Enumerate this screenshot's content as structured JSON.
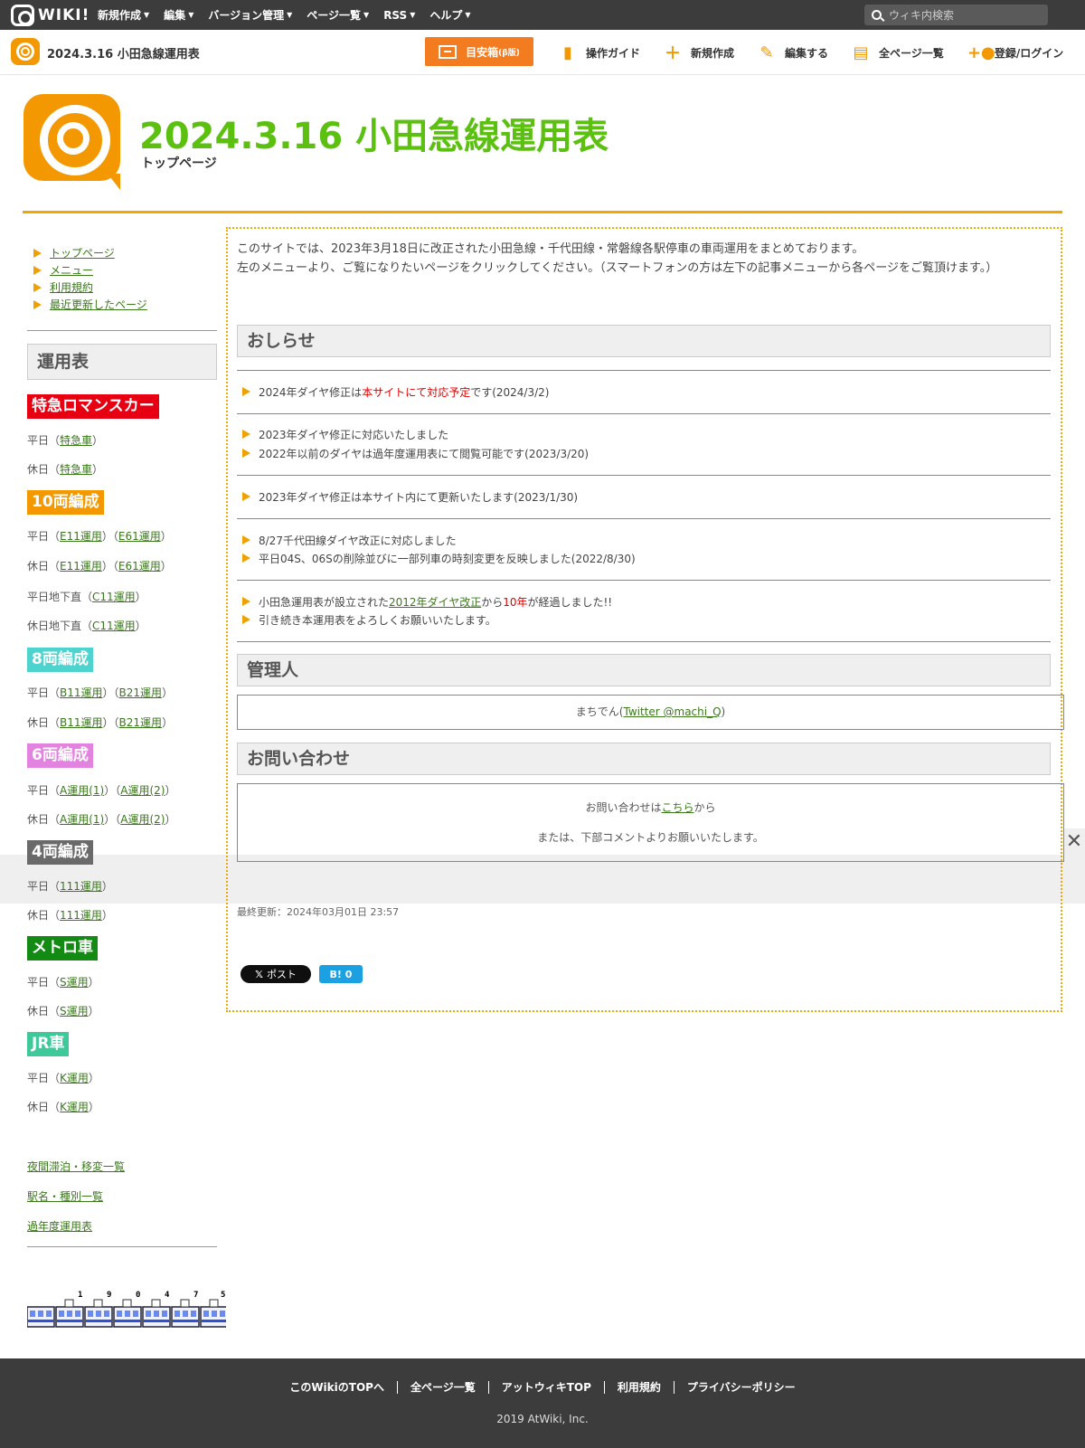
{
  "topbar": {
    "logo_text": "WIKI!",
    "nav": [
      "新規作成",
      "編集",
      "バージョン管理",
      "ページ一覧",
      "RSS",
      "ヘルプ"
    ],
    "search_placeholder": "ウィキ内検索"
  },
  "subbar": {
    "site_title": "2024.3.16 小田急線運用表",
    "mokuji_label": "目安箱",
    "mokuji_small": "(β版)",
    "tools": [
      {
        "icon": "book-icon",
        "label": "操作ガイド"
      },
      {
        "icon": "plus-icon",
        "label": "新規作成"
      },
      {
        "icon": "pencil-icon",
        "label": "編集する"
      },
      {
        "icon": "document-icon",
        "label": "全ページ一覧"
      },
      {
        "icon": "users-icon",
        "label": "登録/ログイン"
      }
    ]
  },
  "header": {
    "title": "2024.3.16 小田急線運用表",
    "subtitle": "トップページ"
  },
  "sidebar": {
    "links": [
      "トップページ",
      "メニュー",
      "利用規約",
      "最近更新したページ"
    ],
    "heading": "運用表",
    "categories": [
      {
        "name": "特急ロマンスカー",
        "color": "#e60012"
      },
      {
        "name": "10両編成",
        "color": "#f39800"
      },
      {
        "name": "8両編成",
        "color": "#4fd3cf"
      },
      {
        "name": "6両編成",
        "color": "#e383e0"
      },
      {
        "name": "4両編成",
        "color": "#6a6a6a"
      },
      {
        "name": "メトロ車",
        "color": "#138a13"
      },
      {
        "name": "JR車",
        "color": "#3ec99a"
      }
    ],
    "rows": {
      "romance_weekday": {
        "prefix": "平日（",
        "links": [
          "特急車"
        ],
        "suffix": "）"
      },
      "romance_holiday": {
        "prefix": "休日（",
        "links": [
          "特急車"
        ],
        "suffix": "）"
      },
      "ten_weekday": {
        "prefix": "平日（",
        "links": [
          "E11運用",
          "E61運用"
        ]
      },
      "ten_holiday": {
        "prefix": "休日（",
        "links": [
          "E11運用",
          "E61運用"
        ]
      },
      "ten_sub_weekday": {
        "prefix": "平日地下直（",
        "links": [
          "C11運用"
        ]
      },
      "ten_sub_holiday": {
        "prefix": "休日地下直（",
        "links": [
          "C11運用"
        ]
      },
      "eight_weekday": {
        "prefix": "平日（",
        "links": [
          "B11運用",
          "B21運用"
        ]
      },
      "eight_holiday": {
        "prefix": "休日（",
        "links": [
          "B11運用",
          "B21運用"
        ]
      },
      "six_weekday": {
        "prefix": "平日（",
        "links": [
          "A運用(1)",
          "A運用(2)"
        ]
      },
      "six_holiday": {
        "prefix": "休日（",
        "links": [
          "A運用(1)",
          "A運用(2)"
        ]
      },
      "four_weekday": {
        "prefix": "平日（",
        "links": [
          "111運用"
        ]
      },
      "four_holiday": {
        "prefix": "休日（",
        "links": [
          "111運用"
        ]
      },
      "metro_weekday": {
        "prefix": "平日（",
        "links": [
          "S運用"
        ]
      },
      "metro_holiday": {
        "prefix": "休日（",
        "links": [
          "S運用"
        ]
      },
      "jr_weekday": {
        "prefix": "平日（",
        "links": [
          "K運用"
        ]
      },
      "jr_holiday": {
        "prefix": "休日（",
        "links": [
          "K運用"
        ]
      }
    },
    "bottom_links": [
      "夜間滞泊・移変一覧",
      "駅名・種別一覧",
      "過年度運用表"
    ],
    "train_numbers": [
      "1",
      "9",
      "0",
      "4",
      "7",
      "5"
    ]
  },
  "main": {
    "intro_line1": "このサイトでは、2023年3月18日に改正された小田急線・千代田線・常磐線各駅停車の車両運用をまとめております。",
    "intro_line2": "左のメニューより、ご覧になりたいページをクリックしてください。（スマートフォンの方は左下の記事メニューから各ページをご覧頂けます。）",
    "notice_heading": "おしらせ",
    "news": {
      "n1_a": "2024年ダイヤ修正は",
      "n1_red": "本サイトにて対応予定",
      "n1_b": "です(2024/3/2)",
      "n2": "2023年ダイヤ修正に対応いたしました",
      "n3": "2022年以前のダイヤは過年度運用表にて閲覧可能です(2023/3/20)",
      "n4": "2023年ダイヤ修正は本サイト内にて更新いたします(2023/1/30)",
      "n5": "8/27千代田線ダイヤ改正に対応しました",
      "n6": "平日04S、06Sの削除並びに一部列車の時刻変更を反映しました(2022/8/30)",
      "n7_a": "小田急運用表が設立された",
      "n7_link": "2012年ダイヤ改正",
      "n7_b": "から",
      "n7_red": "10年",
      "n7_c": "が経過しました!!",
      "n8": "引き続き本運用表をよろしくお願いいたします。"
    },
    "admin_heading": "管理人",
    "admin_prefix": "まちでん(",
    "admin_link": "Twitter @machi_Q",
    "admin_suffix": ")",
    "contact_heading": "お問い合わせ",
    "contact_prefix": "お問い合わせは",
    "contact_link": "こちら",
    "contact_suffix": "から",
    "contact_line2": "または、下部コメントよりお願いいたします。",
    "updated": "最終更新：2024年03月01日 23:57",
    "tweet_label": "ポスト",
    "hatena_label": "B!",
    "hatena_count": "0"
  },
  "footer": {
    "links": [
      "このWikiのTOPへ",
      "全ページ一覧",
      "アットウィキTOP",
      "利用規約",
      "プライバシーポリシー"
    ],
    "copyright": "2019 AtWiki, Inc."
  }
}
